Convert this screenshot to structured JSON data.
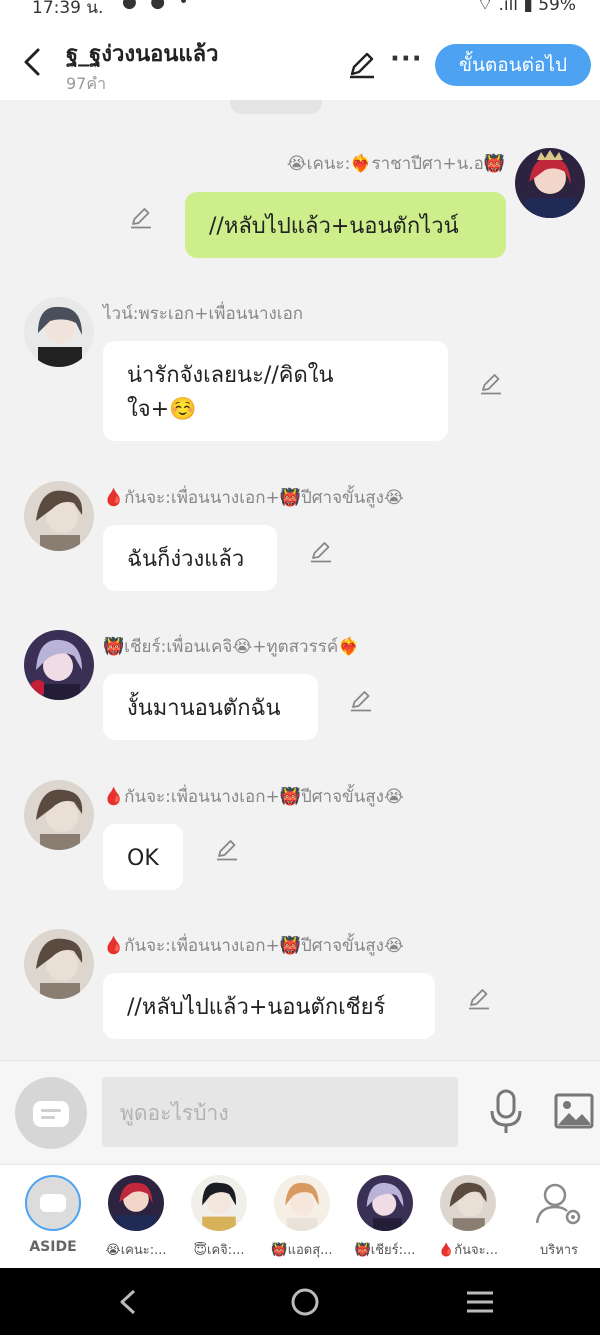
{
  "status_bar": {
    "time": "17:39 น.",
    "battery": "59%"
  },
  "header": {
    "title": "ฐ_ฐง่วงนอนแล้ว",
    "word_count": "97คำ",
    "next_button": "ขั้นตอนต่อไป"
  },
  "messages": [
    {
      "speaker": "😭เคนะ:❤️‍🔥ราชาปีศา+น.อ👹",
      "text": "//หลับไปแล้ว+นอนตักไวน์",
      "mine": true
    },
    {
      "speaker": "ไวน์:พระเอก+เพื่อนนางเอก",
      "text": "น่ารักจังเลยนะ//คิดใน",
      "text2": "ใจ+☺️"
    },
    {
      "speaker": "🩸กันจะ:เพื่อนนางเอก+👹ปีศาจขั้นสูง😭",
      "text": "ฉันก็ง่วงแล้ว"
    },
    {
      "speaker": "👹เชียร์:เพื่อนเคจิ😭+ทูตสวรรค์❤️‍🔥",
      "text": "งั้นมานอนตักฉัน"
    },
    {
      "speaker": "🩸กันจะ:เพื่อนนางเอก+👹ปีศาจขั้นสูง😭",
      "text": "OK"
    },
    {
      "speaker": "🩸กันจะ:เพื่อนนางเอก+👹ปีศาจขั้นสูง😭",
      "text": "//หลับไปแล้ว+นอนตักเชียร์"
    }
  ],
  "input": {
    "placeholder": "พูดอะไรบ้าง"
  },
  "members": [
    {
      "label": "ASIDE"
    },
    {
      "label": "😭เคนะ:..."
    },
    {
      "label": "😇เคจิ:..."
    },
    {
      "label": "👹แอดสุ..."
    },
    {
      "label": "👹เชียร์:..."
    },
    {
      "label": "🩸กันจะ..."
    },
    {
      "label": "บริหาร"
    }
  ],
  "colors": {
    "accent": "#4da3f2",
    "own_bubble": "#cdee8a",
    "background": "#f2f2f2"
  }
}
